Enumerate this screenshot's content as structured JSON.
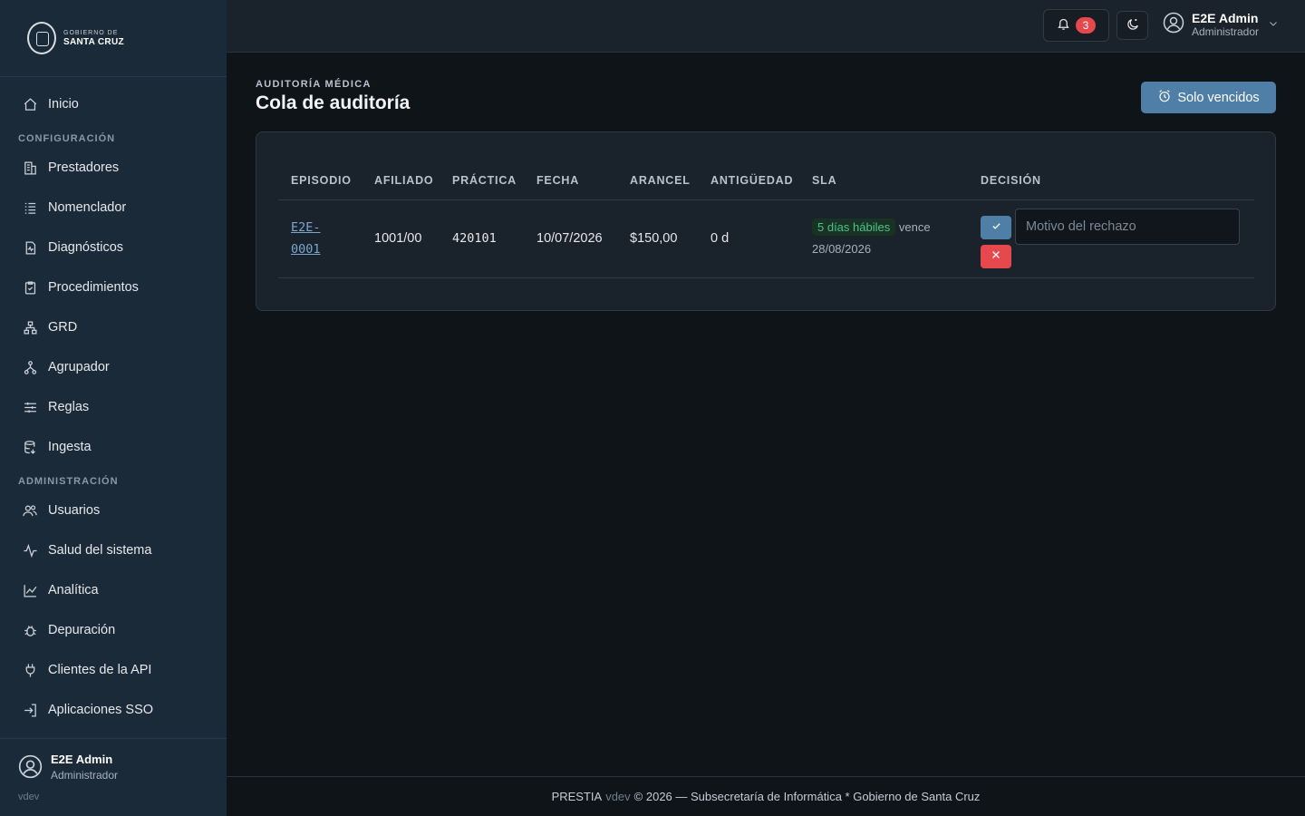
{
  "logo": {
    "line1": "GOBIERNO DE",
    "line2": "SANTA CRUZ"
  },
  "sidebar": {
    "items_top": [
      {
        "label": "Inicio",
        "icon": "home-icon"
      }
    ],
    "section_config": "CONFIGURACIÓN",
    "items_config": [
      {
        "label": "Prestadores",
        "icon": "building-icon"
      },
      {
        "label": "Nomenclador",
        "icon": "list-icon"
      },
      {
        "label": "Diagnósticos",
        "icon": "file-pulse-icon"
      },
      {
        "label": "Procedimientos",
        "icon": "clipboard-check-icon"
      },
      {
        "label": "GRD",
        "icon": "hierarchy-icon"
      },
      {
        "label": "Agrupador",
        "icon": "network-icon"
      },
      {
        "label": "Reglas",
        "icon": "sliders-icon"
      },
      {
        "label": "Ingesta",
        "icon": "database-icon"
      }
    ],
    "section_admin": "ADMINISTRACIÓN",
    "items_admin": [
      {
        "label": "Usuarios",
        "icon": "users-icon"
      },
      {
        "label": "Salud del sistema",
        "icon": "activity-icon"
      },
      {
        "label": "Analítica",
        "icon": "line-chart-icon"
      },
      {
        "label": "Depuración",
        "icon": "bug-icon"
      },
      {
        "label": "Clientes de la API",
        "icon": "plug-icon"
      },
      {
        "label": "Aplicaciones SSO",
        "icon": "login-icon"
      }
    ],
    "user": {
      "name": "E2E Admin",
      "role": "Administrador"
    },
    "version": "vdev"
  },
  "header": {
    "notifications_count": "3",
    "user": {
      "name": "E2E Admin",
      "role": "Administrador"
    }
  },
  "page": {
    "eyebrow": "AUDITORÍA MÉDICA",
    "title": "Cola de auditoría",
    "overdue_button": "Solo vencidos"
  },
  "table": {
    "headers": [
      "EPISODIO",
      "AFILIADO",
      "PRÁCTICA",
      "FECHA",
      "ARANCEL",
      "ANTIGÜEDAD",
      "SLA",
      "DECISIÓN"
    ],
    "rows": [
      {
        "episodio": "E2E-0001",
        "afiliado": "1001/00",
        "practica": "420101",
        "fecha": "10/07/2026",
        "arancel": "$150,00",
        "antiguedad": "0 d",
        "sla_badge": "5 días hábiles",
        "sla_vence": "vence 28/08/2026",
        "reason_placeholder": "Motivo del rechazo"
      }
    ]
  },
  "footer": {
    "brand": "PRESTIA",
    "version": "vdev",
    "text": "© 2026 — Subsecretaría de Informática * Gobierno de Santa Cruz"
  },
  "colors": {
    "accent": "#4f7ea6",
    "danger": "#e5484d",
    "success": "#4cc38a",
    "sidebar": "#1b2a38"
  }
}
